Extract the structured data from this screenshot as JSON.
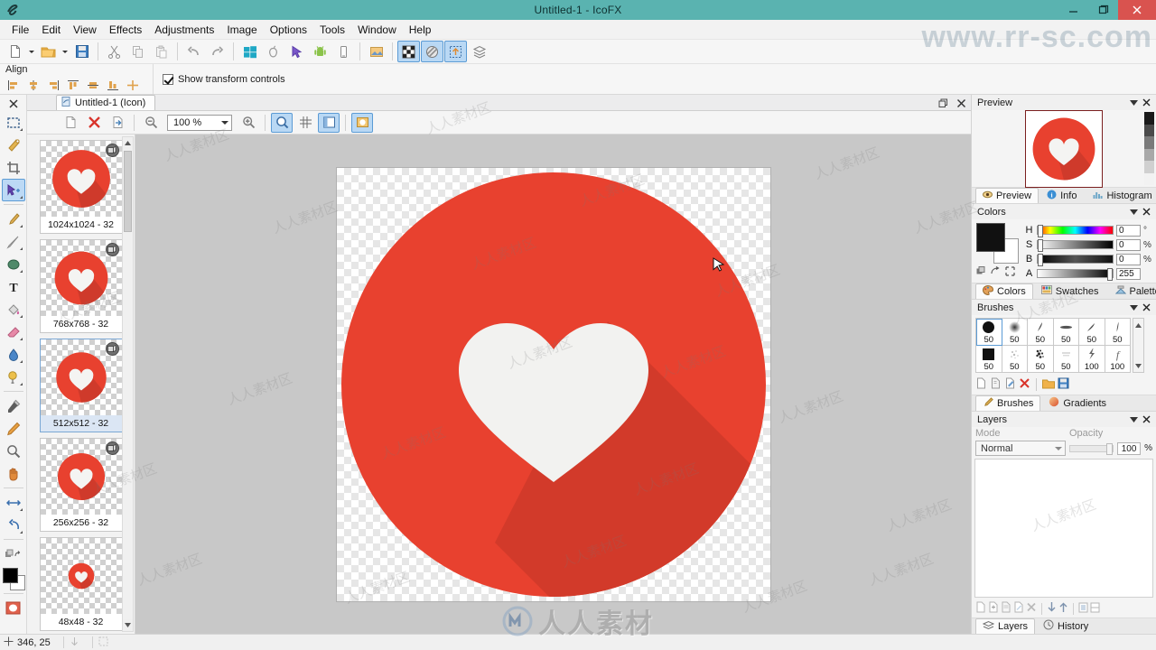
{
  "window": {
    "title": "Untitled-1 - IcoFX",
    "app_icon": "icofx-icon",
    "minimize_label": "—",
    "maximize_label": "❐",
    "close_label": "✕",
    "titlebar_color": "#5ab3b0",
    "close_color": "#d9534f"
  },
  "menubar": {
    "items": [
      {
        "label": "File"
      },
      {
        "label": "Edit"
      },
      {
        "label": "View"
      },
      {
        "label": "Effects"
      },
      {
        "label": "Adjustments"
      },
      {
        "label": "Image"
      },
      {
        "label": "Options"
      },
      {
        "label": "Tools"
      },
      {
        "label": "Window"
      },
      {
        "label": "Help"
      }
    ]
  },
  "toolbar": {
    "buttons": [
      {
        "name": "new-document",
        "icon": "page-icon",
        "state": "off"
      },
      {
        "name": "open-file",
        "icon": "folder-icon",
        "state": "off"
      },
      {
        "name": "save-file",
        "icon": "floppy-disk-icon",
        "state": "off"
      },
      {
        "name": "cut",
        "icon": "scissors-icon",
        "state": "off"
      },
      {
        "name": "copy",
        "icon": "copy-icon",
        "state": "off"
      },
      {
        "name": "paste",
        "icon": "paste-icon",
        "state": "off"
      },
      {
        "name": "undo",
        "icon": "undo-arrow-icon",
        "state": "off"
      },
      {
        "name": "redo",
        "icon": "redo-arrow-icon",
        "state": "off"
      },
      {
        "name": "windows-icon-export",
        "icon": "windows-logo-icon",
        "state": "off"
      },
      {
        "name": "macos-icon-export",
        "icon": "apple-logo-icon",
        "state": "off"
      },
      {
        "name": "cursor-export",
        "icon": "mouse-cursor-icon",
        "state": "off"
      },
      {
        "name": "android-icon-export",
        "icon": "android-robot-icon",
        "state": "off"
      },
      {
        "name": "ios-icon-export",
        "icon": "phone-icon",
        "state": "off"
      },
      {
        "name": "image-tools",
        "icon": "picture-tool-icon",
        "state": "off"
      },
      {
        "name": "toggle-transparency-grid",
        "icon": "checkerboard-icon",
        "state": "on"
      },
      {
        "name": "toggle-overlay",
        "icon": "sphere-icon",
        "state": "on"
      },
      {
        "name": "toggle-selection-frame",
        "icon": "selection-frame-icon",
        "state": "on"
      },
      {
        "name": "layers-stack",
        "icon": "layers-stack-icon",
        "state": "off"
      }
    ]
  },
  "options_bar": {
    "align_label": "Align",
    "align_buttons": [
      "align-left-icon",
      "align-center-h-icon",
      "align-right-icon",
      "align-top-icon",
      "align-middle-v-icon",
      "align-bottom-icon",
      "align-center-icon"
    ],
    "show_transform_controls": {
      "label": "Show transform controls",
      "checked": true
    }
  },
  "tools_panel": {
    "close_label": "✕",
    "tools": [
      {
        "name": "rectangular-marquee-tool",
        "icon": "dashed-rectangle-icon",
        "selected": false,
        "has_submenu": true
      },
      {
        "name": "magic-wand-tool",
        "icon": "magic-wand-icon",
        "selected": false,
        "has_submenu": false
      },
      {
        "name": "crop-tool",
        "icon": "crop-icon",
        "selected": false,
        "has_submenu": false
      },
      {
        "name": "move-tool",
        "icon": "move-arrow-icon",
        "selected": true,
        "has_submenu": true
      },
      {
        "name": "brush-tool",
        "icon": "paintbrush-icon",
        "selected": false,
        "has_submenu": true
      },
      {
        "name": "line-tool",
        "icon": "pencil-line-icon",
        "selected": false,
        "has_submenu": true
      },
      {
        "name": "shape-tool",
        "icon": "ellipse-shape-icon",
        "selected": false,
        "has_submenu": true
      },
      {
        "name": "text-tool",
        "icon": "text-t-icon",
        "selected": false,
        "has_submenu": false
      },
      {
        "name": "paint-bucket-tool",
        "icon": "paint-bucket-icon",
        "selected": false,
        "has_submenu": true
      },
      {
        "name": "eraser-tool",
        "icon": "eraser-icon",
        "selected": false,
        "has_submenu": true
      },
      {
        "name": "blur-tool",
        "icon": "water-drop-icon",
        "selected": false,
        "has_submenu": true
      },
      {
        "name": "dodge-burn-tool",
        "icon": "dodge-icon",
        "selected": false,
        "has_submenu": true
      },
      {
        "name": "eyedropper-tool",
        "icon": "eyedropper-icon",
        "selected": false,
        "has_submenu": false
      },
      {
        "name": "color-replace-tool",
        "icon": "color-pen-icon",
        "selected": false,
        "has_submenu": false
      },
      {
        "name": "zoom-tool",
        "icon": "magnifier-icon",
        "selected": false,
        "has_submenu": false
      },
      {
        "name": "hand-tool",
        "icon": "hand-icon",
        "selected": false,
        "has_submenu": false
      },
      {
        "name": "flip-tool",
        "icon": "flip-horizontal-icon",
        "selected": false,
        "has_submenu": true
      },
      {
        "name": "rotate-tool",
        "icon": "rotate-icon",
        "selected": false,
        "has_submenu": true
      }
    ],
    "swap_colors_icon": "swap-colors-icon",
    "foreground_color": "#000000",
    "background_color": "#ffffff",
    "quick_mask_icon": "quick-mask-icon"
  },
  "document": {
    "tab": {
      "label": "Untitled-1 (Icon)",
      "icon": "document-icon"
    },
    "window_buttons": {
      "restore": "restore-icon",
      "close": "close-icon"
    },
    "doc_toolbar": {
      "buttons": [
        {
          "name": "new-image",
          "icon": "new-page-icon",
          "state": "off"
        },
        {
          "name": "delete-image",
          "icon": "red-x-icon",
          "state": "off"
        },
        {
          "name": "export-image",
          "icon": "export-page-icon",
          "state": "off"
        },
        {
          "name": "zoom-out",
          "icon": "zoom-out-icon",
          "state": "off"
        },
        {
          "name": "zoom-in",
          "icon": "zoom-in-icon",
          "state": "off"
        },
        {
          "name": "preview-toggle",
          "icon": "magnifier-blue-icon",
          "state": "on"
        },
        {
          "name": "grid-toggle",
          "icon": "grid-icon",
          "state": "off"
        },
        {
          "name": "panel-toggle",
          "icon": "panel-icon",
          "state": "on"
        },
        {
          "name": "background-toggle",
          "icon": "background-icon",
          "state": "on"
        }
      ],
      "zoom_value": "100 %"
    },
    "icon_list": [
      {
        "size_label": "1024x1024 - 32",
        "selected": false,
        "badge": true,
        "thumb_scale": 1.0
      },
      {
        "size_label": "768x768 - 32",
        "selected": false,
        "badge": true,
        "thumb_scale": 0.93
      },
      {
        "size_label": "512x512 - 32",
        "selected": true,
        "badge": true,
        "thumb_scale": 0.88
      },
      {
        "size_label": "256x256 - 32",
        "selected": false,
        "badge": true,
        "thumb_scale": 0.82
      },
      {
        "size_label": "48x48 - 32",
        "selected": false,
        "badge": false,
        "thumb_scale": 0.45
      }
    ],
    "canvas": {
      "circle_color": "#e8412f",
      "shadow_color": "#cf3a2b",
      "heart_color": "#f2f2f0"
    }
  },
  "panels": {
    "preview": {
      "title": "Preview",
      "collapse_icon": "chevron-down-icon",
      "close_icon": "close-icon",
      "tabs": [
        {
          "label": "Preview",
          "icon": "eye-icon",
          "active": true
        },
        {
          "label": "Info",
          "icon": "info-icon",
          "active": false
        },
        {
          "label": "Histogram",
          "icon": "histogram-icon",
          "active": false
        }
      ]
    },
    "colors": {
      "title": "Colors",
      "collapse_icon": "chevron-down-icon",
      "close_icon": "close-icon",
      "foreground": "#111111",
      "background": "#ffffff",
      "small_icons": [
        "copy-color-icon",
        "swap-colors-icon",
        "reset-colors-icon"
      ],
      "sliders": [
        {
          "label": "H",
          "value": "0",
          "unit": "°",
          "knob_pct": 0
        },
        {
          "label": "S",
          "value": "0",
          "unit": "%",
          "knob_pct": 0
        },
        {
          "label": "B",
          "value": "0",
          "unit": "%",
          "knob_pct": 0
        },
        {
          "label": "A",
          "value": "255",
          "unit": "",
          "knob_pct": 100
        }
      ],
      "tabs": [
        {
          "label": "Colors",
          "icon": "palette-blob-icon",
          "active": true
        },
        {
          "label": "Swatches",
          "icon": "swatches-icon",
          "active": false
        },
        {
          "label": "Palette",
          "icon": "palette-icon",
          "active": false
        }
      ]
    },
    "brushes": {
      "title": "Brushes",
      "collapse_icon": "chevron-down-icon",
      "close_icon": "close-icon",
      "items": [
        {
          "size": "50",
          "style": "hard-round",
          "selected": true
        },
        {
          "size": "50",
          "style": "soft-round",
          "selected": false
        },
        {
          "size": "50",
          "style": "slanted-stroke",
          "selected": false
        },
        {
          "size": "50",
          "style": "flat-stroke",
          "selected": false
        },
        {
          "size": "50",
          "style": "tapered-stroke",
          "selected": false
        },
        {
          "size": "50",
          "style": "thin-tapered",
          "selected": false
        },
        {
          "size": "50",
          "style": "hard-square",
          "selected": false
        },
        {
          "size": "50",
          "style": "spatter",
          "selected": false
        },
        {
          "size": "50",
          "style": "dense-spatter",
          "selected": false
        },
        {
          "size": "50",
          "style": "faint-texture",
          "selected": false
        },
        {
          "size": "100",
          "style": "lightning",
          "selected": false
        },
        {
          "size": "100",
          "style": "script-f",
          "selected": false
        }
      ],
      "action_icons": [
        "new-brush-icon",
        "duplicate-brush-icon",
        "edit-brush-icon",
        "delete-brush-icon",
        "open-folder-icon",
        "save-brush-icon"
      ],
      "tabs": [
        {
          "label": "Brushes",
          "icon": "paintbrush-icon",
          "active": true
        },
        {
          "label": "Gradients",
          "icon": "gradient-circle-icon",
          "active": false
        }
      ]
    },
    "layers": {
      "title": "Layers",
      "collapse_icon": "chevron-down-icon",
      "close_icon": "close-icon",
      "mode_label": "Mode",
      "opacity_label": "Opacity",
      "mode_value": "Normal",
      "opacity_value": "100",
      "opacity_unit": "%",
      "action_icons": [
        "new-layer-icon",
        "add-layer-icon",
        "duplicate-layer-icon",
        "layer-effects-icon",
        "delete-layer-icon",
        "move-down-icon",
        "move-up-icon",
        "merge-down-icon",
        "flatten-icon"
      ],
      "tabs": [
        {
          "label": "Layers",
          "icon": "layers-icon",
          "active": true
        },
        {
          "label": "History",
          "icon": "clock-icon",
          "active": false
        }
      ]
    }
  },
  "statusbar": {
    "cursor_icon": "crosshair-icon",
    "coordinates": "346, 25",
    "size_icon": "size-icon",
    "selection_icon": "selection-icon"
  },
  "watermarks": {
    "url": "www.rr-sc.com",
    "logo_text": "人人素材",
    "tile_text": "人人素材区"
  }
}
